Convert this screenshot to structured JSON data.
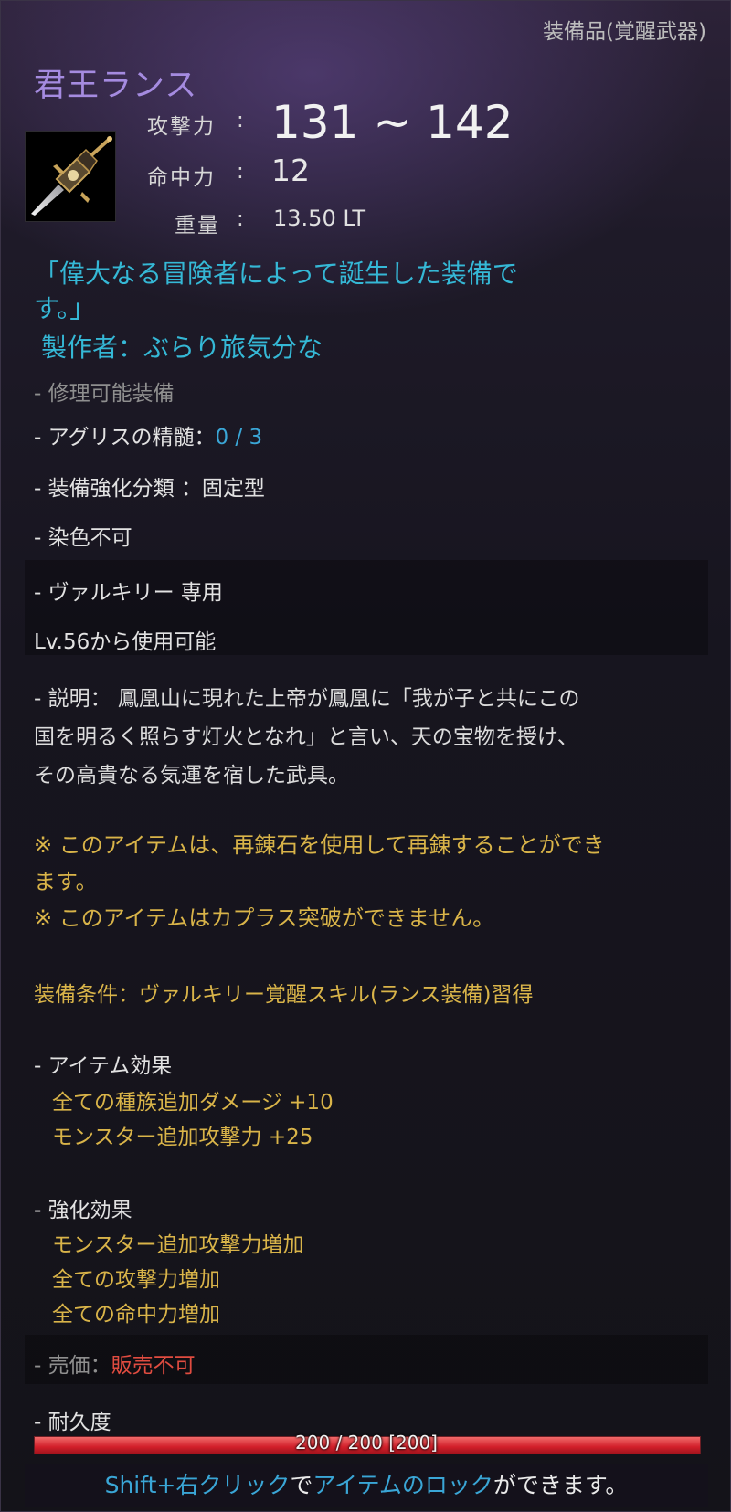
{
  "header": {
    "category": "装備品(覚醒武器)",
    "item_name": "君王ランス"
  },
  "stats": {
    "attack_label": "攻撃力",
    "attack_value": "131 ~ 142",
    "accuracy_label": "命中力",
    "accuracy_value": "12",
    "weight_label": "重量",
    "weight_value": "13.50 LT",
    "separator": ":"
  },
  "flavor": {
    "line1": "「偉大なる冒険者によって誕生した装備で",
    "line2": "す。」",
    "maker": "製作者：ぶらり旅気分な"
  },
  "properties": {
    "repairable": "- 修理可能装備",
    "agris_label": "- アグリスの精髄：",
    "agris_value": "0 / 3",
    "enhance_type": "- 装備強化分類 ：固定型",
    "dye": "- 染色不可",
    "class_only": "- ヴァルキリー 専用",
    "level_req": "Lv.56から使用可能"
  },
  "description": {
    "line1": "- 説明： 鳳凰山に現れた上帝が鳳凰に「我が子と共にこの",
    "line2": "国を明るく照らす灯火となれ」と言い、天の宝物を授け、",
    "line3": "その高貴なる気運を宿した武具。"
  },
  "notices": {
    "refine_line1": "※ このアイテムは、再錬石を使用して再錬することができ",
    "refine_line2": "ます。",
    "caphras": "※ このアイテムはカプラス突破ができません。"
  },
  "requirement": "装備条件：ヴァルキリー覚醒スキル(ランス装備)習得",
  "item_effects": {
    "title": "- アイテム効果",
    "effects": [
      "全ての種族追加ダメージ +10",
      "モンスター追加攻撃力 +25"
    ]
  },
  "enhance_effects": {
    "title": "- 強化効果",
    "effects": [
      "モンスター追加攻撃力増加",
      "全ての攻撃力増加",
      "全ての命中力増加"
    ]
  },
  "sale": {
    "label": "- 売価：",
    "value": "販売不可"
  },
  "durability": {
    "title": "- 耐久度",
    "text": "200 / 200 [200]",
    "current": 200,
    "max": 200,
    "fill_fraction": 1.0
  },
  "footer": {
    "part1": "Shift+右クリック",
    "part2": "で",
    "part3": "アイテムのロック",
    "part4": "ができます。"
  },
  "colors": {
    "name": "#a58be0",
    "flavor": "#35b8d6",
    "value_blue": "#3aa6d6",
    "gold": "#d9b449",
    "red": "#e04c40",
    "bar_red": "#d21f2a"
  },
  "icons": {
    "item": "lance-icon"
  }
}
